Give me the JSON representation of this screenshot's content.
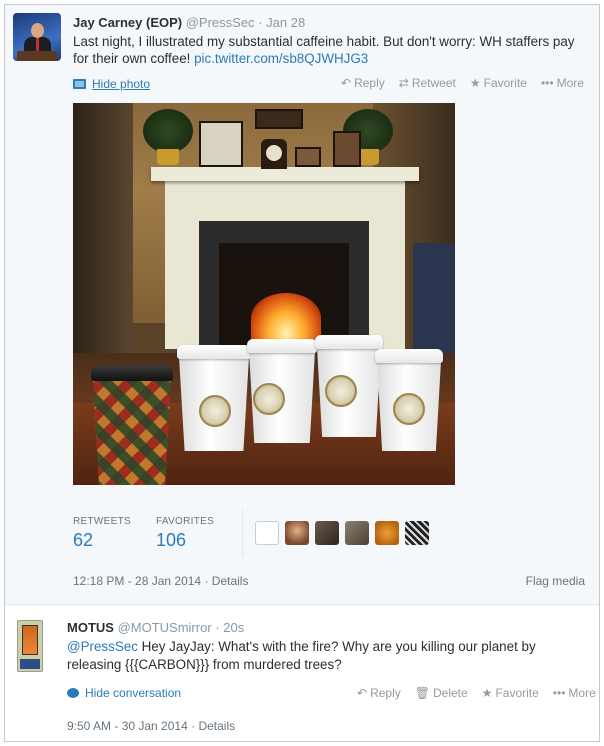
{
  "tweet1": {
    "author_name": "Jay Carney (EOP)",
    "handle": "@PressSec",
    "time": "Jan 28",
    "text_main": "Last night, I illustrated my substantial caffeine habit.  But don't worry: WH staffers pay for their own coffee!",
    "link": "pic.twitter.com/sb8QJWHJG3",
    "actions": {
      "reply": "Reply",
      "retweet": "Retweet",
      "favorite": "Favorite",
      "more": "More"
    },
    "hide_photo": "Hide photo",
    "stats": {
      "retweets_label": "RETWEETS",
      "retweets_value": "62",
      "favorites_label": "FAVORITES",
      "favorites_value": "106"
    },
    "timestamp": "12:18 PM - 28 Jan 2014",
    "details": "Details",
    "flag_media": "Flag media"
  },
  "tweet2": {
    "author_name": "MOTUS",
    "handle": "@MOTUSmirror",
    "time": "20s",
    "mention": "@PressSec",
    "text_rest": " Hey JayJay: What's with the fire? Why are you killing our planet by releasing {{{CARBON}}} from murdered trees?",
    "hide_conversation": "Hide conversation",
    "actions": {
      "reply": "Reply",
      "delete": "Delete",
      "favorite": "Favorite",
      "more": "More"
    },
    "timestamp": "9:50 AM - 30 Jan 2014",
    "details": "Details"
  },
  "icons": {
    "reply": "reply-arrow-icon",
    "retweet": "retweet-icon",
    "favorite": "star-icon",
    "more": "ellipsis-icon",
    "delete": "trash-icon",
    "photo": "photo-icon",
    "conversation": "speech-bubble-icon"
  },
  "colors": {
    "link": "#2b7bb9",
    "meta": "#8899a6",
    "tweet_bg": "#f5f8fa"
  }
}
